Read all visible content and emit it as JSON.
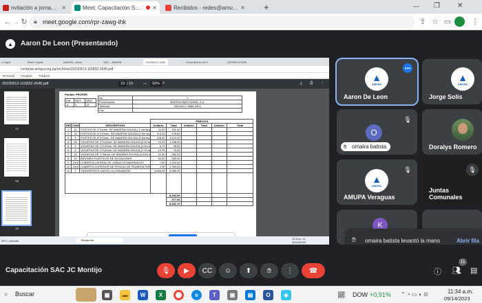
{
  "browser": {
    "tabs": [
      {
        "label": "nvitación a jornada de AMUP"
      },
      {
        "label": "Meet: Capacitación SAC JC M"
      },
      {
        "label": "Recibidos - redes@amupa.org.pa"
      }
    ],
    "new_tab": "+",
    "url": "meet.google.com/rpr-zawg-ihk"
  },
  "meet": {
    "presenter_banner": "Aaron De Leon (Presentando)",
    "meeting_title": "Capacitación SAC JC Montijo",
    "participant_count": "11",
    "participants": [
      {
        "name": "Aaron De Leon"
      },
      {
        "name": "Jorge Solís"
      },
      {
        "name": "omaira batista",
        "initial": "O"
      },
      {
        "name": "Doralys Romero"
      },
      {
        "name": "AMUPA Veraguas"
      },
      {
        "name": "Juntas Comunales"
      },
      {
        "name": "",
        "initial": "K"
      }
    ],
    "hand_raise": {
      "text": "omaira batista levantó la mano",
      "action": "Abrir fila"
    }
  },
  "shared_screen": {
    "inner_tabs": [
      "c Capa",
      "Meet: Capac",
      "AMUPA – Asoc",
      "SAC – AMUPA",
      "20230913-1158",
      "Crear Anexo de Li",
      "20230914-0929"
    ],
    "url": "compras.amupa.org.pa/archivos/20230913-115832-2645.pdf",
    "bookmarks": [
      "M Gmail",
      "Youtube",
      "Traducir"
    ],
    "pdf_title": "20230913-115832-2645.pdf",
    "page": "19",
    "pages": "/ 19",
    "zoom": "93%",
    "thumbs": [
      "17",
      "18",
      "19"
    ],
    "share_notice": "meet.google.com está compartiendo tu pantalla.",
    "share_stop": "Dejar de compartir",
    "share_hide": "Ocultar",
    "search": "Búsqueda",
    "temp": "28°C, soleado",
    "time": "12:24 p. m.",
    "date": "09/14/2023"
  },
  "document": {
    "partida": "Partida: PROPER",
    "header": {
      "dia": "DIA",
      "mes": "MES",
      "ano": "AÑO",
      "dia_v": "11",
      "mes_v": "9",
      "ano_v": "23"
    },
    "no_label": "No.",
    "no_value": "1",
    "proveedores_label": "Proveedores",
    "proveedores_value": "INVERSIONES ROINA, S.A.",
    "telefono_label": "Teléfono:",
    "telefono_value": "339-6421 / 5986-2904",
    "fax_label": "Fax",
    "precios": "PRECIOS",
    "columns": [
      "REG",
      "CANT",
      "DESCRIPCION",
      "Unitario",
      "Total",
      "Unitario",
      "Total",
      "Unitario",
      "Total"
    ],
    "rows": [
      [
        "1",
        "41",
        "POSTES DE 3\"X4mm, DE MADERA SOLIDA ( 1.0m largo)",
        "11.00",
        "451.00"
      ],
      [
        "2",
        "43",
        "POSTES DE 6\"X10mm. DE MADERA SOLIDA (2.5m largo)",
        "113.00",
        "478.00"
      ],
      [
        "3",
        "5",
        "POSTES DE 8\"X10mm. DE MADERA SOLIDA (3.5m largo)",
        "128.00",
        "4,114.00"
      ],
      [
        "4",
        "62",
        "VIGUETAS DE 4\"X10mm. DE MADERA SOLIDA (5.00 largo)",
        "12.00",
        "1,188.00"
      ],
      [
        "5",
        "6",
        "VIGUETAS DE 4\"X10mm. DE MADERA SOLIDA (3.0m largo)",
        "6.75",
        "58.50"
      ],
      [
        "6",
        "6",
        "VIGUETAS DE 4\"X10mm. DE MADERA SOLIDA (7.00 largo)",
        "12.75",
        "76.50"
      ],
      [
        "7",
        "32",
        "VIGUETAS DE 2\"X6mm. DE MADERA SOLIDA (3.00m largo)",
        "11.00",
        "352.00"
      ],
      [
        "8",
        "10",
        "BIDONES PLASTICOS DE 55 GALONES",
        "50.00",
        "500.00"
      ],
      [
        "9",
        "1000",
        "CUBIERTA LATERAL DE CAÑAZOS AMARRADOS",
        "7.00",
        "7,000.00"
      ],
      [
        "10",
        "1000",
        "CUBIERTA SUPERIOR DE PENCAS DE PALMERA SOBRE ENTRAMADO DE MADERA DE 1.5\"X2\"APROXIMADAMENTE",
        "2.95",
        "2,950.00"
      ],
      [
        "11",
        "1",
        "TRANSPORTE HASTA LA COMUNIDAD",
        "3,685.00",
        "3,685.00"
      ]
    ],
    "totals": [
      "8,254.50",
      "577.60",
      "8,832.10"
    ]
  },
  "taskbar": {
    "search": "Buscar",
    "stock": "DOW",
    "stock_change": "+0,91%",
    "time": "11:34 a.m.",
    "date": "09/14/2023"
  }
}
